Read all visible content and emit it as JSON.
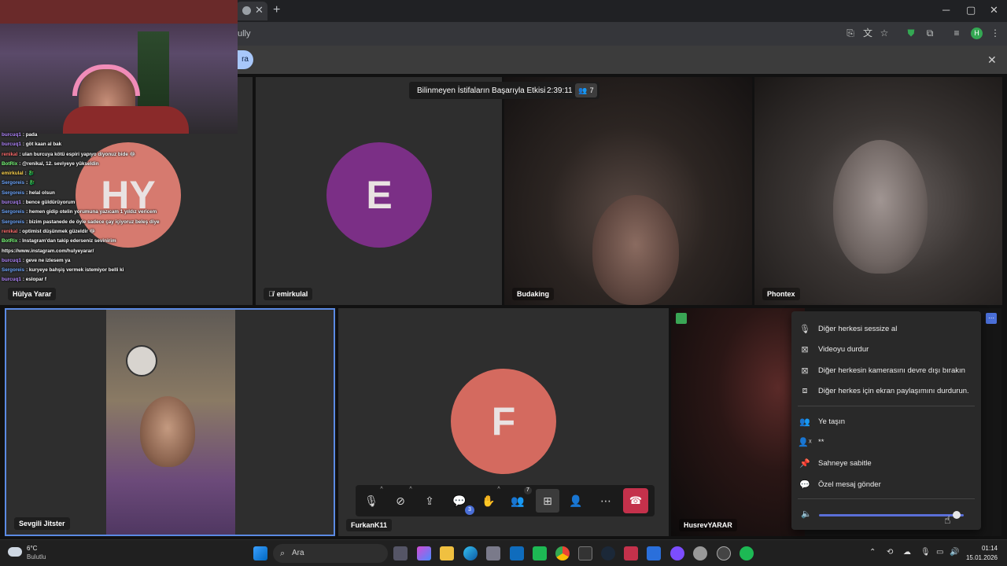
{
  "browser": {
    "tab_close": "✕",
    "new_tab": "+",
    "url_fragment": "ully",
    "profile_initial": "H",
    "win_min": "─",
    "win_max": "▢",
    "win_close": "✕",
    "infobar_pill": "ra",
    "infobar_close": "✕"
  },
  "meeting": {
    "title": "Bilinmeyen İstifaların Başarıyla Etkisi",
    "elapsed": "2:39:11",
    "participant_count": "7",
    "tiles": [
      {
        "name": "Hülya Yarar",
        "initials": "HY",
        "color": "#d67a6f"
      },
      {
        "name": "emirkulal",
        "initials": "E",
        "color": "#7b2f86"
      },
      {
        "name": "Budaking"
      },
      {
        "name": "Phontex"
      },
      {
        "name": "Sevgili Jitster"
      },
      {
        "name": "FurkanK11",
        "initials": "F",
        "color": "#d46a5f"
      },
      {
        "name": "HusrevYARAR"
      }
    ]
  },
  "chat": [
    {
      "user": "burcuq1",
      "msg": ": pada",
      "color": "#b388ff"
    },
    {
      "user": "burcuq1",
      "msg": ": göt kaan al bak",
      "color": "#b388ff"
    },
    {
      "user": "renikal",
      "msg": ": ulan burcuya kötü espiri yapıyo diyonuz bide 😂",
      "color": "#ff6e6e"
    },
    {
      "user": "BotRix",
      "msg": ": @renikal, 12. seviyeye yükseldin",
      "color": "#7cff7c"
    },
    {
      "user": "emirkulal",
      "msg": ": 🐉",
      "color": "#ffd54f"
    },
    {
      "user": "Sergoreis",
      "msg": ": 🐉",
      "color": "#6fa8ff"
    },
    {
      "user": "Sergoreis",
      "msg": ": helal olsun",
      "color": "#6fa8ff"
    },
    {
      "user": "burcuq1",
      "msg": ": bence güldürüyorum",
      "color": "#b388ff"
    },
    {
      "user": "Sergoreis",
      "msg": ": hemen gidip otelin yorumuna yazıcam 1 yıldız vericem",
      "color": "#6fa8ff"
    },
    {
      "user": "Sergoreis",
      "msg": ": bizim pastanede de öyle sadece çay içiyoruz beleş diye",
      "color": "#6fa8ff"
    },
    {
      "user": "renikal",
      "msg": ": optimist düşünmek güzeldir 😂",
      "color": "#ff6e6e"
    },
    {
      "user": "BotRix",
      "msg": ": Instagram'dan takip ederseniz sevinirim",
      "color": "#7cff7c"
    },
    {
      "user": "",
      "msg": "https://www.instagram.com/hulyeyarar/",
      "color": "#ffffff"
    },
    {
      "user": "burcuq1",
      "msg": ": geve ne izlesem ya",
      "color": "#b388ff"
    },
    {
      "user": "Sergoreis",
      "msg": ": kuryeye bahşiş vermek istemiyor belli ki",
      "color": "#6fa8ff"
    },
    {
      "user": "burcuq1",
      "msg": ": eslopar f",
      "color": "#b388ff"
    }
  ],
  "controls": {
    "chat_badge": "3",
    "participants_badge": "7",
    "icons": [
      "mic-icon",
      "camera-off-icon",
      "share-screen-icon",
      "chat-icon",
      "raise-hand-icon",
      "participants-icon",
      "grid-view-icon",
      "add-person-icon",
      "more-icon",
      "leave-call-icon"
    ]
  },
  "context_menu": {
    "items": [
      "Diğer herkesi sessize al",
      "Videoyu durdur",
      "Diğer herkesin kamerasını devre dışı bırakın",
      "Diğer herkes için ekran paylaşımını durdurun.",
      "Ye taşın",
      "**",
      "Sahneye sabitle",
      "Özel mesaj gönder"
    ],
    "volume_percent": 95
  },
  "taskbar": {
    "weather_temp": "6°C",
    "weather_desc": "Bulutlu",
    "search_placeholder": "Ara",
    "time": "01:14",
    "date": "15.01.2026"
  }
}
